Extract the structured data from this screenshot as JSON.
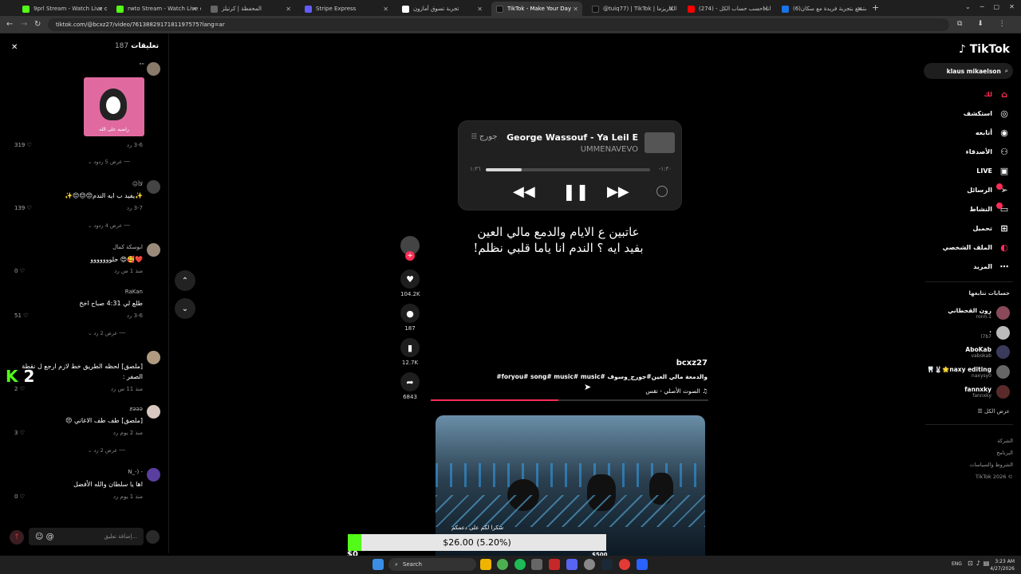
{
  "tabs": [
    {
      "title": "9prl Stream - Watch Live on Ki",
      "color": "#53fc18"
    },
    {
      "title": "rwto Stream - Watch Live on Ki",
      "color": "#53fc18"
    },
    {
      "title": "المحفظة | كرتيلز",
      "color": "#666"
    },
    {
      "title": "Stripe Express",
      "color": "#635bff"
    },
    {
      "title": "تجربة تسوق أمازون",
      "color": "#fff"
    },
    {
      "title": "TikTok - Make Your Day",
      "color": "#111"
    },
    {
      "title": "@tuiq77) | TikTok | ملك الكاريزما",
      "color": "#111"
    },
    {
      "title": "انا احسب حساب الكل - (274) be",
      "color": "#ff0000"
    },
    {
      "title": "(6)استمتع بتجربة فريدة مع سكان",
      "color": "#1a73e8"
    }
  ],
  "address": "tiktok.com/@bcxz27/video/7613882917181197575?lang=ar",
  "comments": {
    "title": "تعليقات",
    "count": "187",
    "items": [
      {
        "name": "\"\"",
        "text": "",
        "sub": "3-6   رد",
        "likes": "319",
        "replies": "عرض 5 ردود"
      },
      {
        "name": "لاأ‏😑",
        "text": "✨يفيد ب ايه الندم😔😔😔✨",
        "sub": "3-7   رد",
        "likes": "139",
        "replies": "عرض 4 ردود"
      },
      {
        "name": "ابوسكة كمال",
        "text": "❤️🥰😍 حلووووووو",
        "sub": "منذ 1 س   رد",
        "likes": "0",
        "replies": ""
      },
      {
        "name": "RaKan",
        "text": "طلع لي 4:31 صباح اخخ",
        "sub": "3-6   رد",
        "likes": "51",
        "replies": "عرض 2 رد"
      },
      {
        "name": "",
        "text": "[ملصق] لحظه الطريق خط لازم ارجع ل نقطة",
        "text2": "الصفر :",
        "sub": "منذ 11 س   رد",
        "likes": "2",
        "replies": ""
      },
      {
        "name": "ƶǝǝǝ",
        "text": "[ملصق] طف طف الاغاني 😣",
        "sub": "منذ 2 يوم   رد",
        "likes": "3",
        "replies": "عرض 2 رد"
      },
      {
        "name": "- (-_N",
        "text": "اها يا سلطان والله الأفضل",
        "sub": "منذ 1 يوم   رد",
        "likes": "0",
        "replies": ""
      }
    ],
    "sticker_caption": "راضيه على الله",
    "input_placeholder": "إضافة تعليق..."
  },
  "kick_overlay": "2",
  "player": {
    "song": "George Wassouf - Ya Leil E",
    "artist": "UMMENAVEVO",
    "badge": "جورج",
    "elapsed": "١:٣٦",
    "remaining": "-١:٣٠",
    "progress": 0.22
  },
  "lyrics": [
    "عاتبين ع الايام والدمع مالي العين",
    "بفيد ايه ؟ الندم انا ياما قلبي نظلم!"
  ],
  "actions": {
    "likes": "104.2K",
    "comments": "187",
    "saves": "12.7K",
    "shares": "6843"
  },
  "video": {
    "author": "bcxz27",
    "desc": "والدمعة مالي العين#جورج_وسوف #foryou# song# music# music#",
    "sound": "الصوت الأصلي - تقس",
    "next_caption": "شكرا لكم على دعمكم"
  },
  "donation": {
    "amount": "$26.00 (5.20%)",
    "min": "$0",
    "max": "$500",
    "progress": 0.052
  },
  "nav": {
    "logo": "TikTok",
    "search": "klaus mikaelson",
    "items": [
      "لك",
      "استكشف",
      "أتابعه",
      "الأصدقاء",
      "LIVE",
      "الرسائل",
      "النشاط",
      "تحميل",
      "الملف الشخصي",
      "المزيد"
    ],
    "following_title": "حسابات تتابعها",
    "following": [
      {
        "name": "رون القحطاني",
        "handle": "ronn.1"
      },
      {
        "name": ".",
        "handle": "l7b7"
      },
      {
        "name": "AboKab",
        "handle": "vabokab"
      },
      {
        "name": "naxy editing🌟🐰🦷",
        "handle": "naxysy0"
      },
      {
        "name": "fannxky",
        "handle": "fannxky"
      }
    ],
    "see_all": "عرض الكل",
    "footer": [
      "الشركة",
      "البرنامج",
      "الشروط والسياسات",
      "TikTok 2026 ©"
    ]
  },
  "taskbar": {
    "search": "Search",
    "lang": "ENG",
    "time": "3:23 AM",
    "date": "4/27/2026"
  }
}
